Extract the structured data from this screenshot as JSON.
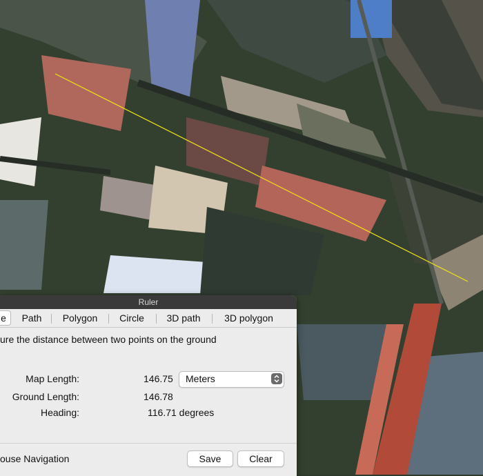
{
  "ruler": {
    "title": "Ruler",
    "tabs": [
      {
        "label": "e",
        "active": true
      },
      {
        "label": "Path"
      },
      {
        "label": "Polygon"
      },
      {
        "label": "Circle"
      },
      {
        "label": "3D path"
      },
      {
        "label": "3D polygon"
      }
    ],
    "description": "ure the distance between two points on the ground",
    "map_length": {
      "label": "Map Length:",
      "value": "146.75"
    },
    "unit": {
      "selected": "Meters"
    },
    "ground_length": {
      "label": "Ground Length:",
      "value": "146.78"
    },
    "heading": {
      "label": "Heading:",
      "value": "116.71 degrees"
    },
    "navigation_label": "ouse Navigation",
    "save_label": "Save",
    "clear_label": "Clear"
  },
  "colors": {
    "measure_line": "#f2e21a",
    "panel_bg": "#ececec",
    "title_bar": "#3a3a3a"
  },
  "icons": {
    "unit_select": "chevron-up-down-icon"
  }
}
